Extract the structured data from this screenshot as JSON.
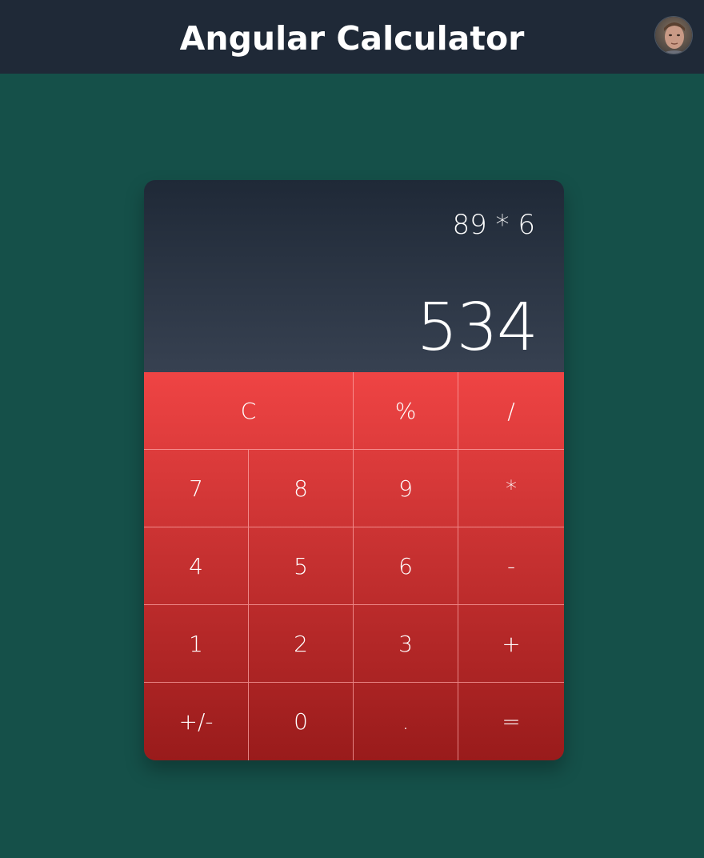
{
  "header": {
    "title": "Angular Calculator",
    "avatar_icon": "user-avatar"
  },
  "colors": {
    "page_background": "#155049",
    "header_background": "#1f2937",
    "screen_gradient_top": "#1f2937",
    "screen_gradient_bottom": "#374151",
    "keypad_gradient_top": "#ef4444",
    "keypad_gradient_bottom": "#991b1b"
  },
  "display": {
    "expression": "89 * 6",
    "result": "534"
  },
  "keypad": {
    "clear": "C",
    "percent": "%",
    "divide": "/",
    "seven": "7",
    "eight": "8",
    "nine": "9",
    "multiply": "*",
    "four": "4",
    "five": "5",
    "six": "6",
    "subtract": "-",
    "one": "1",
    "two": "2",
    "three": "3",
    "add": "+",
    "negate": "+/-",
    "zero": "0",
    "decimal": ".",
    "equals": "="
  }
}
